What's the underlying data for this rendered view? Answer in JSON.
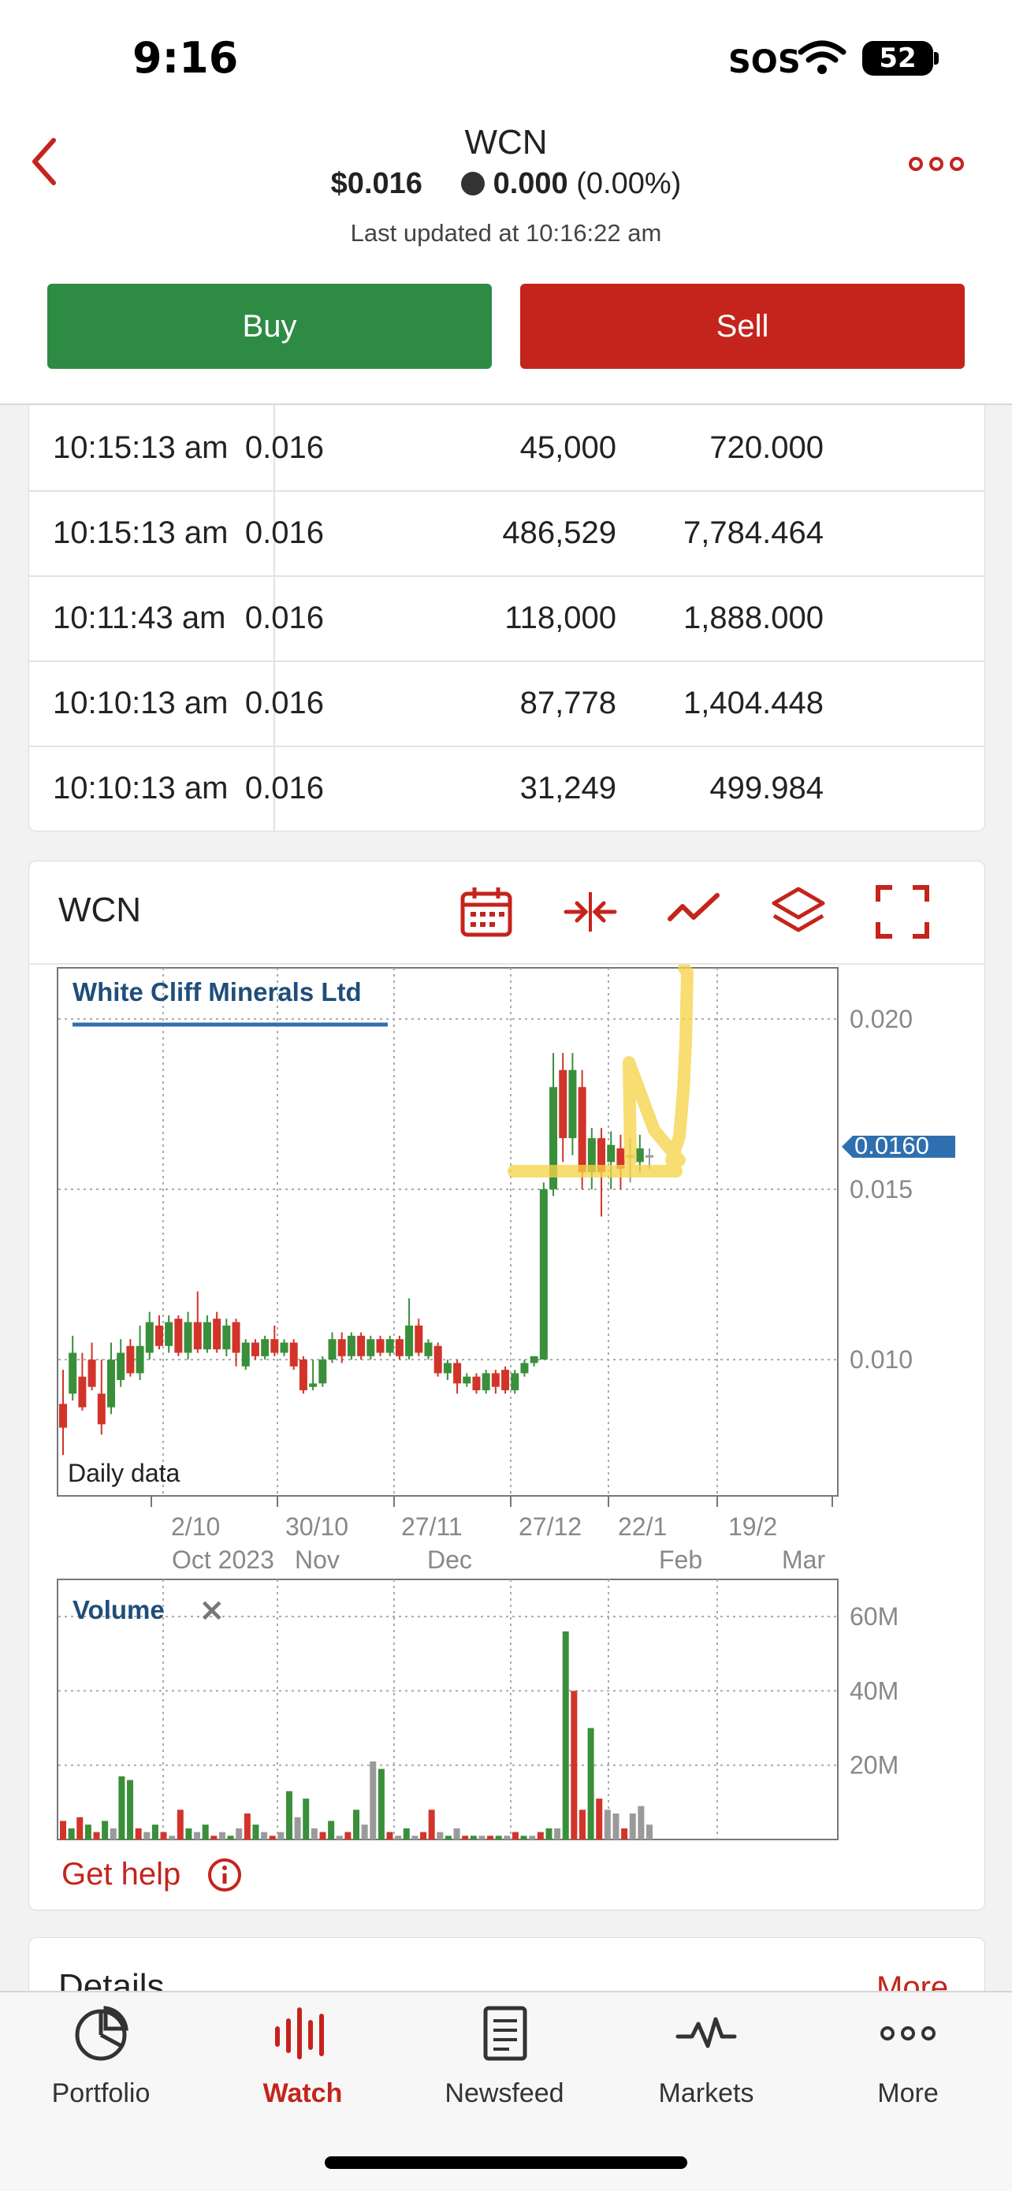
{
  "status": {
    "time": "9:16",
    "sos": "SOS",
    "battery": "52"
  },
  "header": {
    "ticker": "WCN",
    "price": "$0.016",
    "change": "0.000",
    "change_pct": "(0.00%)",
    "updated": "Last updated at 10:16:22 am",
    "buy_label": "Buy",
    "sell_label": "Sell"
  },
  "trades": [
    {
      "time": "10:15:13 am",
      "price": "0.016",
      "volume": "45,000",
      "value": "720.000"
    },
    {
      "time": "10:15:13 am",
      "price": "0.016",
      "volume": "486,529",
      "value": "7,784.464"
    },
    {
      "time": "10:11:43 am",
      "price": "0.016",
      "volume": "118,000",
      "value": "1,888.000"
    },
    {
      "time": "10:10:13 am",
      "price": "0.016",
      "volume": "87,778",
      "value": "1,404.448"
    },
    {
      "time": "10:10:13 am",
      "price": "0.016",
      "volume": "31,249",
      "value": "499.984"
    }
  ],
  "chart_card": {
    "title": "WCN",
    "icons": [
      "calendar-icon",
      "compress-icon",
      "line-chart-icon",
      "layers-icon",
      "fullscreen-icon"
    ],
    "get_help": "Get help"
  },
  "chart_data": [
    {
      "type": "candlestick",
      "title": "White Cliff Minerals Ltd",
      "note": "Daily data",
      "ylim": [
        0.006,
        0.0215
      ],
      "y_ticks": [
        "0.020",
        "0.015",
        "0.010"
      ],
      "current_price_label": "0.0160",
      "x_ticks_top": [
        "2/10",
        "30/10",
        "27/11",
        "27/12",
        "22/1",
        "19/2"
      ],
      "x_ticks_bottom": [
        "Oct 2023",
        "Nov",
        "Dec",
        "",
        "Feb",
        "Mar"
      ],
      "series": [
        {
          "values": [
            {
              "o": 0.0087,
              "c": 0.008,
              "h": 0.0097,
              "l": 0.0072
            },
            {
              "o": 0.009,
              "c": 0.0102,
              "h": 0.0107,
              "l": 0.0088
            },
            {
              "o": 0.0095,
              "c": 0.0086,
              "h": 0.0102,
              "l": 0.0085
            },
            {
              "o": 0.01,
              "c": 0.0092,
              "h": 0.0105,
              "l": 0.0091
            },
            {
              "o": 0.009,
              "c": 0.0081,
              "h": 0.01,
              "l": 0.0078
            },
            {
              "o": 0.0086,
              "c": 0.01,
              "h": 0.0105,
              "l": 0.0084
            },
            {
              "o": 0.0094,
              "c": 0.0102,
              "h": 0.0106,
              "l": 0.0092
            },
            {
              "o": 0.0104,
              "c": 0.0096,
              "h": 0.0106,
              "l": 0.0095
            },
            {
              "o": 0.0096,
              "c": 0.0104,
              "h": 0.011,
              "l": 0.0094
            },
            {
              "o": 0.0102,
              "c": 0.0111,
              "h": 0.0114,
              "l": 0.01
            },
            {
              "o": 0.011,
              "c": 0.0104,
              "h": 0.0113,
              "l": 0.0103
            },
            {
              "o": 0.0104,
              "c": 0.0111,
              "h": 0.0113,
              "l": 0.0102
            },
            {
              "o": 0.0112,
              "c": 0.0102,
              "h": 0.0113,
              "l": 0.0101
            },
            {
              "o": 0.0102,
              "c": 0.0111,
              "h": 0.0114,
              "l": 0.01
            },
            {
              "o": 0.0111,
              "c": 0.0103,
              "h": 0.012,
              "l": 0.0102
            },
            {
              "o": 0.0103,
              "c": 0.0111,
              "h": 0.0113,
              "l": 0.0102
            },
            {
              "o": 0.0112,
              "c": 0.0103,
              "h": 0.0114,
              "l": 0.0102
            },
            {
              "o": 0.0103,
              "c": 0.011,
              "h": 0.0112,
              "l": 0.0101
            },
            {
              "o": 0.0111,
              "c": 0.0102,
              "h": 0.0112,
              "l": 0.0098
            },
            {
              "o": 0.0098,
              "c": 0.0105,
              "h": 0.0106,
              "l": 0.0097
            },
            {
              "o": 0.0105,
              "c": 0.0101,
              "h": 0.0106,
              "l": 0.01
            },
            {
              "o": 0.0101,
              "c": 0.0106,
              "h": 0.0107,
              "l": 0.01
            },
            {
              "o": 0.0106,
              "c": 0.0102,
              "h": 0.011,
              "l": 0.0101
            },
            {
              "o": 0.0102,
              "c": 0.0105,
              "h": 0.0106,
              "l": 0.0101
            },
            {
              "o": 0.0105,
              "c": 0.0098,
              "h": 0.0106,
              "l": 0.0097
            },
            {
              "o": 0.01,
              "c": 0.0091,
              "h": 0.0101,
              "l": 0.009
            },
            {
              "o": 0.0092,
              "c": 0.0093,
              "h": 0.01,
              "l": 0.0091
            },
            {
              "o": 0.0093,
              "c": 0.01,
              "h": 0.0101,
              "l": 0.0092
            },
            {
              "o": 0.01,
              "c": 0.0106,
              "h": 0.0108,
              "l": 0.0099
            },
            {
              "o": 0.0106,
              "c": 0.0101,
              "h": 0.0108,
              "l": 0.0099
            },
            {
              "o": 0.0101,
              "c": 0.0107,
              "h": 0.0108,
              "l": 0.01
            },
            {
              "o": 0.0107,
              "c": 0.0101,
              "h": 0.0108,
              "l": 0.01
            },
            {
              "o": 0.0101,
              "c": 0.0106,
              "h": 0.0107,
              "l": 0.01
            },
            {
              "o": 0.0106,
              "c": 0.0102,
              "h": 0.0107,
              "l": 0.0101
            },
            {
              "o": 0.0102,
              "c": 0.0106,
              "h": 0.0107,
              "l": 0.0101
            },
            {
              "o": 0.0106,
              "c": 0.0101,
              "h": 0.0107,
              "l": 0.01
            },
            {
              "o": 0.0101,
              "c": 0.011,
              "h": 0.0118,
              "l": 0.01
            },
            {
              "o": 0.011,
              "c": 0.0102,
              "h": 0.0112,
              "l": 0.0101
            },
            {
              "o": 0.0101,
              "c": 0.0105,
              "h": 0.0106,
              "l": 0.01
            },
            {
              "o": 0.0104,
              "c": 0.0096,
              "h": 0.0105,
              "l": 0.0095
            },
            {
              "o": 0.0096,
              "c": 0.0099,
              "h": 0.01,
              "l": 0.0094
            },
            {
              "o": 0.0099,
              "c": 0.0093,
              "h": 0.01,
              "l": 0.009
            },
            {
              "o": 0.0093,
              "c": 0.0095,
              "h": 0.0096,
              "l": 0.0092
            },
            {
              "o": 0.0095,
              "c": 0.0091,
              "h": 0.0096,
              "l": 0.009
            },
            {
              "o": 0.0091,
              "c": 0.0096,
              "h": 0.0097,
              "l": 0.009
            },
            {
              "o": 0.0096,
              "c": 0.0092,
              "h": 0.0097,
              "l": 0.009
            },
            {
              "o": 0.0097,
              "c": 0.0091,
              "h": 0.0098,
              "l": 0.009
            },
            {
              "o": 0.0091,
              "c": 0.0096,
              "h": 0.0097,
              "l": 0.009
            },
            {
              "o": 0.0096,
              "c": 0.0099,
              "h": 0.01,
              "l": 0.0095
            },
            {
              "o": 0.0099,
              "c": 0.0101,
              "h": 0.0101,
              "l": 0.0098
            },
            {
              "o": 0.01,
              "c": 0.015,
              "h": 0.0152,
              "l": 0.012
            },
            {
              "o": 0.015,
              "c": 0.018,
              "h": 0.019,
              "l": 0.0148
            },
            {
              "o": 0.0185,
              "c": 0.0165,
              "h": 0.019,
              "l": 0.0158
            },
            {
              "o": 0.0165,
              "c": 0.0185,
              "h": 0.019,
              "l": 0.016
            },
            {
              "o": 0.018,
              "c": 0.0155,
              "h": 0.0185,
              "l": 0.015
            },
            {
              "o": 0.0155,
              "c": 0.0165,
              "h": 0.0168,
              "l": 0.015
            },
            {
              "o": 0.0165,
              "c": 0.0155,
              "h": 0.0168,
              "l": 0.0142
            },
            {
              "o": 0.0158,
              "c": 0.0163,
              "h": 0.0167,
              "l": 0.015
            },
            {
              "o": 0.0162,
              "c": 0.0156,
              "h": 0.0166,
              "l": 0.015
            },
            {
              "o": 0.016,
              "c": 0.016,
              "h": 0.0165,
              "l": 0.0152
            },
            {
              "o": 0.0158,
              "c": 0.0162,
              "h": 0.0166,
              "l": 0.0155
            },
            {
              "o": 0.016,
              "c": 0.016,
              "h": 0.0162,
              "l": 0.0156
            }
          ]
        }
      ]
    },
    {
      "type": "bar",
      "title": "Volume",
      "ylim": [
        0,
        70
      ],
      "y_ticks": [
        "60M",
        "40M",
        "20M"
      ],
      "values": [
        5,
        3,
        6,
        4,
        2,
        5,
        3,
        17,
        16,
        3,
        2,
        4,
        2,
        1,
        8,
        3,
        2,
        4,
        1,
        2,
        1,
        3,
        7,
        4,
        2,
        1,
        2,
        13,
        6,
        11,
        3,
        2,
        5,
        1,
        2,
        8,
        4,
        21,
        19,
        2,
        1,
        3,
        1,
        2,
        8,
        2,
        1,
        3,
        1,
        1,
        1,
        1,
        1,
        1,
        2,
        1,
        1,
        2,
        3,
        3,
        56,
        40,
        8,
        30,
        11,
        8,
        7,
        3,
        7,
        9,
        4
      ],
      "directions": [
        "r",
        "g",
        "r",
        "g",
        "r",
        "g",
        "n",
        "g",
        "g",
        "r",
        "n",
        "g",
        "r",
        "n",
        "r",
        "g",
        "n",
        "g",
        "r",
        "n",
        "g",
        "n",
        "r",
        "g",
        "n",
        "r",
        "n",
        "g",
        "n",
        "g",
        "n",
        "r",
        "g",
        "n",
        "r",
        "g",
        "n",
        "n",
        "g",
        "r",
        "n",
        "g",
        "n",
        "r",
        "r",
        "n",
        "g",
        "n",
        "r",
        "g",
        "n",
        "r",
        "g",
        "n",
        "r",
        "g",
        "n",
        "r",
        "g",
        "n",
        "g",
        "r",
        "r",
        "g",
        "r",
        "n",
        "n",
        "r",
        "n",
        "n",
        "n"
      ]
    }
  ],
  "details": {
    "title": "Details",
    "more": "More"
  },
  "tabs": [
    {
      "label": "Portfolio",
      "icon": "pie-chart-icon",
      "active": false
    },
    {
      "label": "Watch",
      "icon": "watch-bars-icon",
      "active": true
    },
    {
      "label": "Newsfeed",
      "icon": "newsfeed-icon",
      "active": false
    },
    {
      "label": "Markets",
      "icon": "markets-icon",
      "active": false
    },
    {
      "label": "More",
      "icon": "more-dots-icon",
      "active": false
    }
  ],
  "colors": {
    "accent": "#c4241c",
    "buy": "#2e8b44",
    "up": "#3a8f3a",
    "down": "#d2342a",
    "neutral": "#9a9a9a",
    "series_line": "#2f6fb0",
    "price_tag": "#2f6fb0",
    "annotation": "#f5d34a"
  }
}
